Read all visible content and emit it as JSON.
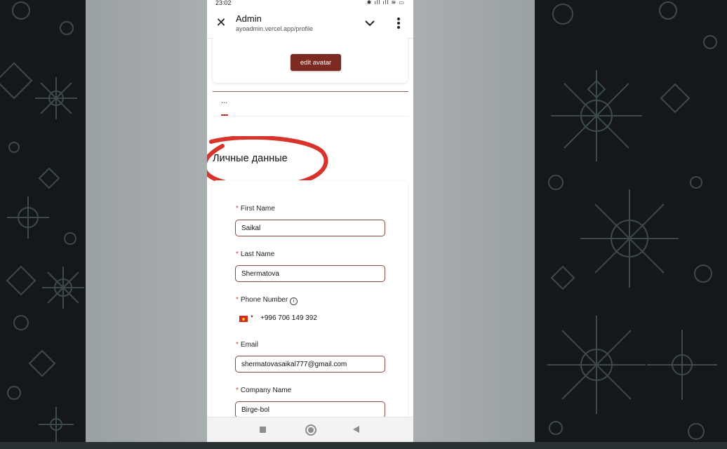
{
  "status": {
    "time": "23:02",
    "icons": "✱ ıll ıll ≋ ▭"
  },
  "appbar": {
    "title": "Admin",
    "url": "ayoadmin.vercel.app/profile"
  },
  "avatar": {
    "edit_label": "edit avatar"
  },
  "tabs": {
    "more_label": "..."
  },
  "section": {
    "title": "Личные данные"
  },
  "form": {
    "first_name": {
      "label": "First Name",
      "value": "Saikal"
    },
    "last_name": {
      "label": "Last Name",
      "value": "Shermatova"
    },
    "phone": {
      "label": "Phone Number",
      "value": "+996 706 149 392"
    },
    "email": {
      "label": "Email",
      "value": "shermatovasaikal777@gmail.com"
    },
    "company": {
      "label": "Company Name",
      "value": "Birge-bol"
    },
    "required_mark": "*"
  },
  "colors": {
    "accent": "#7d2a22",
    "annotation": "#d9342b",
    "required": "#d0453a"
  }
}
